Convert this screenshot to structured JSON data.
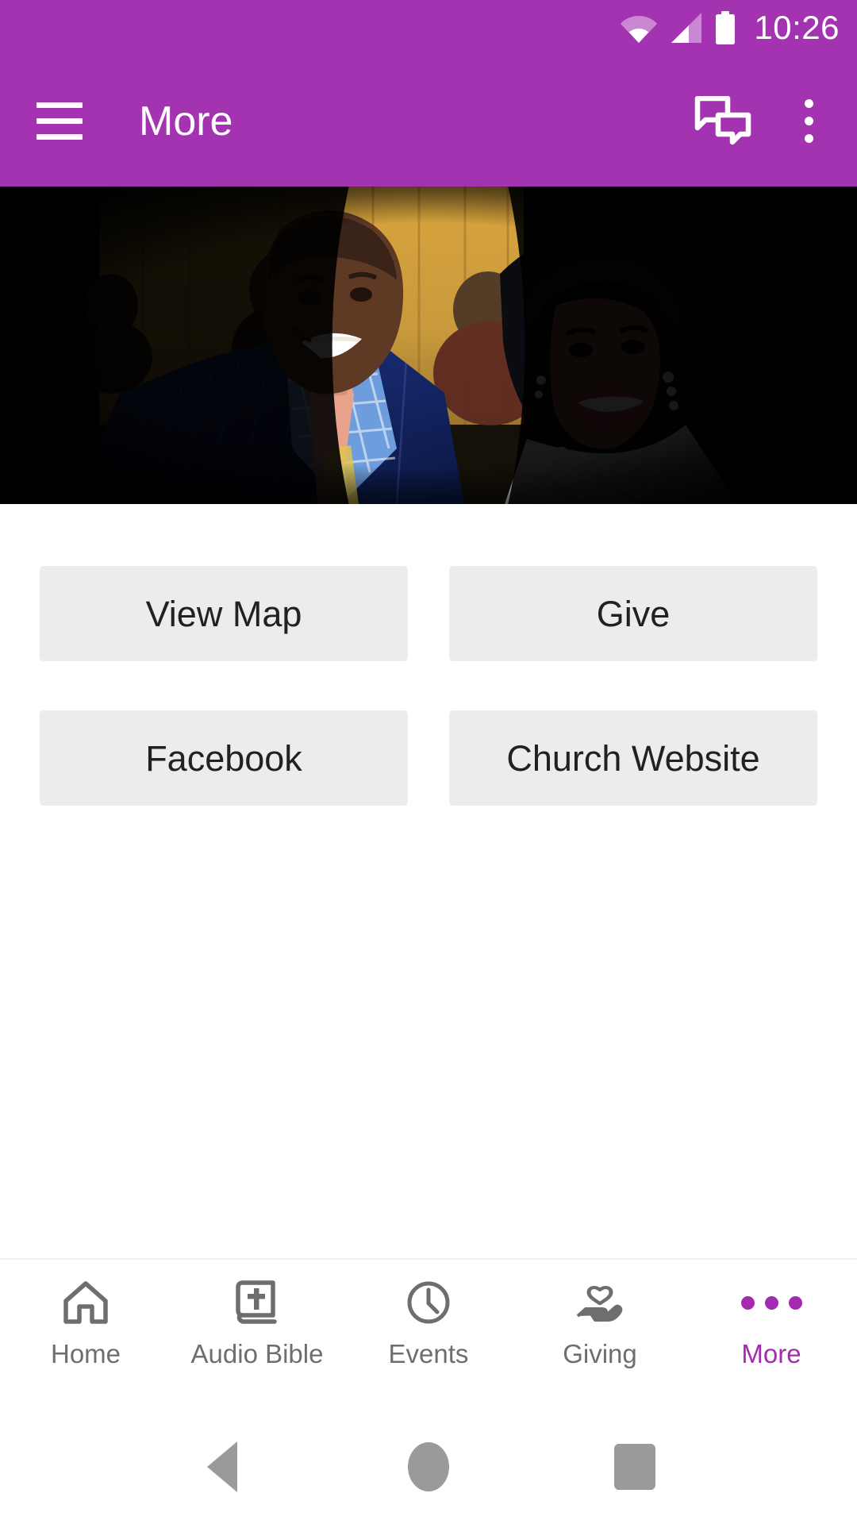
{
  "theme": {
    "primary": "#a333b0",
    "accent": "#a32bb0",
    "tile_bg": "#ececee",
    "tile_text": "#212121",
    "tab_inactive": "#6e6e6e",
    "sysnav_icon": "#9a9a9a"
  },
  "status_bar": {
    "clock": "10:26",
    "wifi_icon": "wifi-icon",
    "signal_icon": "cellular-signal-icon",
    "battery_icon": "battery-full-icon"
  },
  "app_bar": {
    "menu_icon": "hamburger-menu-icon",
    "title": "More",
    "chat_icon": "chat-bubbles-icon",
    "overflow_icon": "overflow-menu-icon"
  },
  "hero": {
    "alt": "church-leaders-photo",
    "description": "Photo of a smiling couple: man in blue pinstripe suit with plaid shirt and peach tie, woman in white top with pearl necklaces, seated audience behind gold curtains"
  },
  "main": {
    "tiles": [
      {
        "label": "View Map",
        "name": "view-map-button"
      },
      {
        "label": "Give",
        "name": "give-button"
      },
      {
        "label": "Facebook",
        "name": "facebook-button"
      },
      {
        "label": "Church Website",
        "name": "church-website-button"
      }
    ]
  },
  "tab_bar": {
    "items": [
      {
        "label": "Home",
        "icon": "house-icon",
        "active": false
      },
      {
        "label": "Audio Bible",
        "icon": "bible-book-icon",
        "active": false
      },
      {
        "label": "Events",
        "icon": "clock-icon",
        "active": false
      },
      {
        "label": "Giving",
        "icon": "hand-heart-icon",
        "active": false
      },
      {
        "label": "More",
        "icon": "three-dots-icon",
        "active": true
      }
    ]
  },
  "system_nav": {
    "back": "back-triangle-icon",
    "home": "home-circle-icon",
    "recents": "recents-square-icon"
  }
}
